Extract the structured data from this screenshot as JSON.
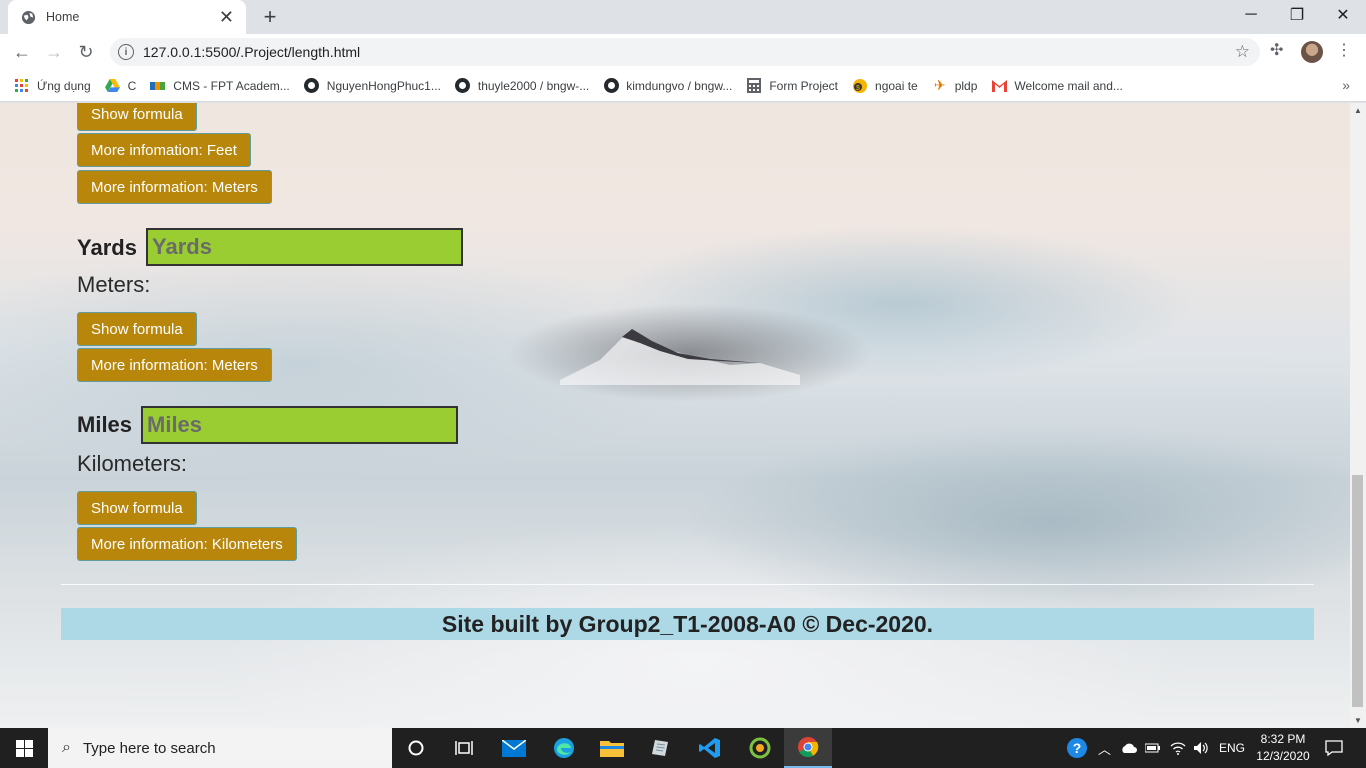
{
  "browser": {
    "tab_title": "Home",
    "url": "127.0.0.1:5500/.Project/length.html",
    "bookmarks": [
      "Ứng dụng",
      "C",
      "CMS - FPT Academ...",
      "NguyenHongPhuc1...",
      "thuyle2000 / bngw-...",
      "kimdungvo / bngw...",
      "Form Project",
      "ngoai te",
      "pldp",
      "Welcome mail and..."
    ]
  },
  "page": {
    "top_buttons": {
      "show_formula": "Show formula",
      "more_feet": "More infomation: Feet",
      "more_meters": "More information: Meters"
    },
    "yards": {
      "label": "Yards",
      "placeholder": "Yards",
      "result_label": "Meters:",
      "show_formula": "Show formula",
      "more_info": "More information: Meters"
    },
    "miles": {
      "label": "Miles",
      "placeholder": "Miles",
      "result_label": "Kilometers:",
      "show_formula": "Show formula",
      "more_info": "More information: Kilometers"
    },
    "footer": "Site built by Group2_T1-2008-A0 © Dec-2020."
  },
  "taskbar": {
    "search_placeholder": "Type here to search",
    "language": "ENG",
    "time": "8:32 PM",
    "date": "12/3/2020"
  }
}
